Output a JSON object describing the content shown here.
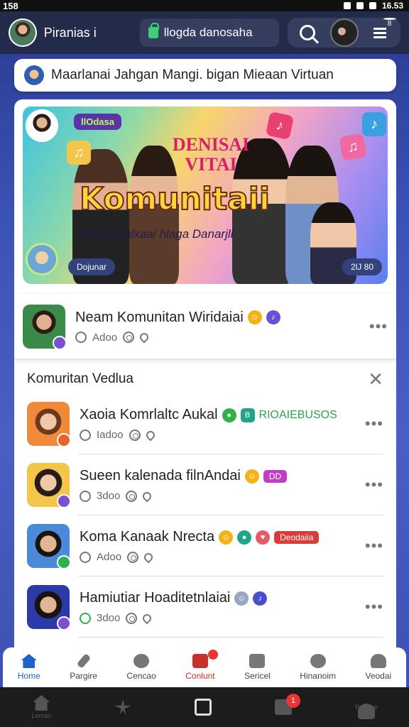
{
  "status_bar": {
    "left": "158",
    "time": "16.53"
  },
  "header": {
    "profile_name": "Piranias i",
    "search_label": "llogda danosaha",
    "notification_count": "8"
  },
  "announcement": {
    "text": "Maarlanai Jahgan Mangi. bigan Mieaan Virtuan"
  },
  "banner": {
    "tag": "llOdasa",
    "headline": "DENISAI VITAI",
    "title": "Komunitaii",
    "subtitle": "Pranlaa alxaai hlaga Danarjll",
    "chip_left": "Dojunar",
    "chip_right": "2lJ 80"
  },
  "featured": {
    "title": "Neam Komunitan Wiridaiai",
    "meta": "Adoo"
  },
  "section": {
    "title": "Komuritan Vedlua"
  },
  "rows": [
    {
      "title": "Xaoia Komrlaltc Aukal",
      "meta": "Iadoo",
      "tag": "RIOAIEBUSOS",
      "tag_color": "#27a84a"
    },
    {
      "title": "Sueen kalenada filnAndai",
      "meta": "3doo",
      "tag": "DD",
      "tag_color": "#c03fc0"
    },
    {
      "title": "Koma Kanaak Nrecta",
      "meta": "Adoo",
      "tag": "Deodaiia",
      "tag_color": "#d93a3a"
    },
    {
      "title": "Hamiutiar Hoaditetnlaiai",
      "meta": "3doo",
      "tag": "",
      "tag_color": ""
    }
  ],
  "app_nav": [
    {
      "label": "Home"
    },
    {
      "label": "Pargire"
    },
    {
      "label": "Cencao"
    },
    {
      "label": "Conlunt"
    },
    {
      "label": "Sericel"
    },
    {
      "label": "Hinanoim"
    },
    {
      "label": "Veodai"
    }
  ],
  "sys_nav": [
    {
      "label": "Lemau"
    },
    {
      "label": ""
    },
    {
      "label": ""
    },
    {
      "label": ""
    },
    {
      "label": "Ranune"
    }
  ],
  "sys_badge": "1",
  "colors": {
    "accent": "#1f63c9",
    "alert": "#c8312a",
    "header_bg": "#242b4a"
  }
}
